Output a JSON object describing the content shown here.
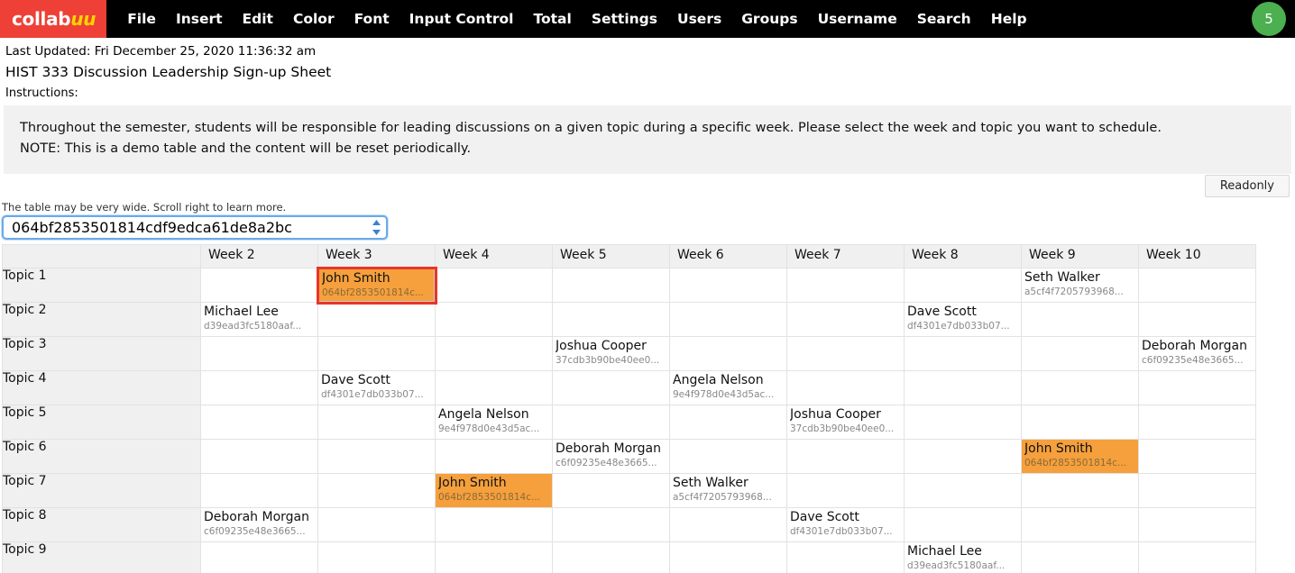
{
  "menubar": {
    "brand_main": "collab",
    "brand_accent": "uu",
    "items": [
      "File",
      "Insert",
      "Edit",
      "Color",
      "Font",
      "Input Control",
      "Total",
      "Settings",
      "Users",
      "Groups",
      "Username",
      "Search",
      "Help"
    ],
    "badge_count": "5",
    "badge_color": "#4caf50",
    "brand_color": "#ee4036",
    "bar_color": "#000000"
  },
  "header": {
    "last_updated": "Last Updated: Fri December 25, 2020 11:36:32 am",
    "sheet_title": "HIST 333 Discussion Leadership Sign-up Sheet",
    "instructions_label": "Instructions:",
    "instructions_line1": "Throughout the semester, students will be responsible for leading discussions on a given topic during a specific week. Please select the week and topic you want to schedule.",
    "instructions_line2": "NOTE: This is a demo table and the content will be reset periodically."
  },
  "toolbar": {
    "readonly_label": "Readonly"
  },
  "selector": {
    "hint": "The table may be very wide. Scroll right to learn more.",
    "value": "064bf2853501814cdf9edca61de8a2bc",
    "focus_color": "#6aa9e9"
  },
  "table": {
    "corner_header": "",
    "columns": [
      "Week 2",
      "Week 3",
      "Week 4",
      "Week 5",
      "Week 6",
      "Week 7",
      "Week 8",
      "Week 9",
      "Week 10"
    ],
    "highlight_color": "#f5a03c",
    "selected_border_color": "#e8352b",
    "rows": [
      {
        "topic": "Topic 1",
        "cells": [
          {},
          {
            "name": "John Smith",
            "uid": "064bf2853501814c...",
            "highlight": true,
            "selected": true
          },
          {},
          {},
          {},
          {},
          {},
          {
            "name": "Seth Walker",
            "uid": "a5cf4f7205793968..."
          },
          {}
        ]
      },
      {
        "topic": "Topic 2",
        "cells": [
          {
            "name": "Michael Lee",
            "uid": "d39ead3fc5180aaf..."
          },
          {},
          {},
          {},
          {},
          {},
          {
            "name": "Dave Scott",
            "uid": "df4301e7db033b07..."
          },
          {},
          {}
        ]
      },
      {
        "topic": "Topic 3",
        "cells": [
          {},
          {},
          {},
          {
            "name": "Joshua Cooper",
            "uid": "37cdb3b90be40ee0..."
          },
          {},
          {},
          {},
          {},
          {
            "name": "Deborah Morgan",
            "uid": "c6f09235e48e3665..."
          }
        ]
      },
      {
        "topic": "Topic 4",
        "cells": [
          {},
          {
            "name": "Dave Scott",
            "uid": "df4301e7db033b07..."
          },
          {},
          {},
          {
            "name": "Angela Nelson",
            "uid": "9e4f978d0e43d5ac..."
          },
          {},
          {},
          {},
          {}
        ]
      },
      {
        "topic": "Topic 5",
        "cells": [
          {},
          {},
          {
            "name": "Angela Nelson",
            "uid": "9e4f978d0e43d5ac..."
          },
          {},
          {},
          {
            "name": "Joshua Cooper",
            "uid": "37cdb3b90be40ee0..."
          },
          {},
          {},
          {}
        ]
      },
      {
        "topic": "Topic 6",
        "cells": [
          {},
          {},
          {},
          {
            "name": "Deborah Morgan",
            "uid": "c6f09235e48e3665..."
          },
          {},
          {},
          {},
          {
            "name": "John Smith",
            "uid": "064bf2853501814c...",
            "highlight": true
          },
          {}
        ]
      },
      {
        "topic": "Topic 7",
        "cells": [
          {},
          {},
          {
            "name": "John Smith",
            "uid": "064bf2853501814c...",
            "highlight": true
          },
          {},
          {
            "name": "Seth Walker",
            "uid": "a5cf4f7205793968..."
          },
          {},
          {},
          {},
          {}
        ]
      },
      {
        "topic": "Topic 8",
        "cells": [
          {
            "name": "Deborah Morgan",
            "uid": "c6f09235e48e3665..."
          },
          {},
          {},
          {},
          {},
          {
            "name": "Dave Scott",
            "uid": "df4301e7db033b07..."
          },
          {},
          {},
          {}
        ]
      },
      {
        "topic": "Topic 9",
        "cells": [
          {},
          {},
          {},
          {},
          {},
          {},
          {
            "name": "Michael Lee",
            "uid": "d39ead3fc5180aaf..."
          },
          {},
          {}
        ]
      }
    ]
  }
}
